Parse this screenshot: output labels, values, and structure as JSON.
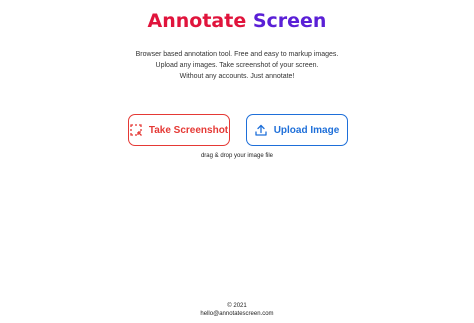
{
  "header": {
    "title_part1": "Annotate",
    "title_part2": "Screen"
  },
  "tagline": {
    "line1": "Browser based annotation tool. Free and easy to markup images.",
    "line2": "Upload any images. Take screenshot of your screen.",
    "line3": "Without any accounts. Just annotate!"
  },
  "actions": {
    "screenshot_label": "Take Screenshot",
    "screenshot_icon": "screenshot-selection-icon",
    "upload_label": "Upload Image",
    "upload_icon": "upload-icon",
    "drop_hint": "drag & drop your image file"
  },
  "colors": {
    "title_part1": "#e0143c",
    "title_part2": "#5a1fd6",
    "screenshot_accent": "#e53935",
    "upload_accent": "#1e6fd9"
  },
  "footer": {
    "copyright": "© 2021",
    "email": "hello@annotatescreen.com"
  }
}
